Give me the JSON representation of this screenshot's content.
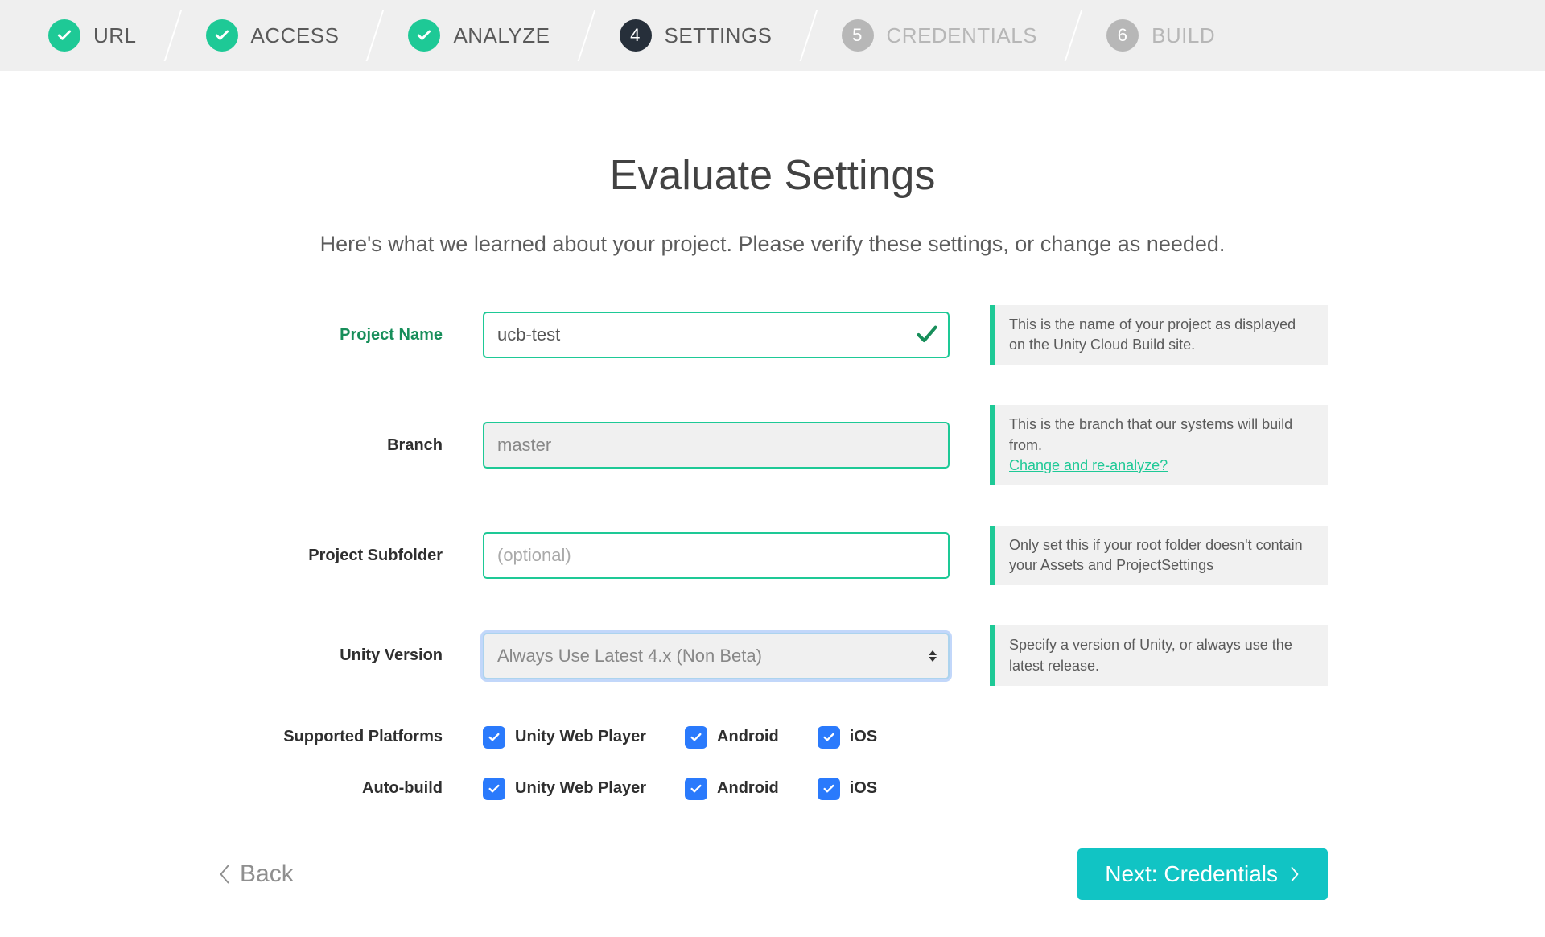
{
  "stepper": {
    "steps": [
      {
        "num": "1",
        "label": "URL",
        "state": "done"
      },
      {
        "num": "2",
        "label": "ACCESS",
        "state": "done"
      },
      {
        "num": "3",
        "label": "ANALYZE",
        "state": "done"
      },
      {
        "num": "4",
        "label": "SETTINGS",
        "state": "current"
      },
      {
        "num": "5",
        "label": "CREDENTIALS",
        "state": "upcoming"
      },
      {
        "num": "6",
        "label": "BUILD",
        "state": "upcoming"
      }
    ]
  },
  "main": {
    "title": "Evaluate Settings",
    "subtitle": "Here's what we learned about your project. Please verify these settings, or change as needed."
  },
  "fields": {
    "project_name": {
      "label": "Project Name",
      "value": "ucb-test",
      "note": "This is the name of your project as displayed on the Unity Cloud Build site.",
      "valid": true
    },
    "branch": {
      "label": "Branch",
      "value": "master",
      "note": "This is the branch that our systems will build from.",
      "note_link": "Change and re-analyze?"
    },
    "subfolder": {
      "label": "Project Subfolder",
      "value": "",
      "placeholder": "(optional)",
      "note": "Only set this if your root folder doesn't contain your Assets and ProjectSettings"
    },
    "unity_version": {
      "label": "Unity Version",
      "value": "Always Use Latest 4.x (Non Beta)",
      "note": "Specify a version of Unity, or always use the latest release."
    },
    "supported_platforms": {
      "label": "Supported Platforms",
      "options": [
        {
          "label": "Unity Web Player",
          "checked": true
        },
        {
          "label": "Android",
          "checked": true
        },
        {
          "label": "iOS",
          "checked": true
        }
      ]
    },
    "auto_build": {
      "label": "Auto-build",
      "options": [
        {
          "label": "Unity Web Player",
          "checked": true
        },
        {
          "label": "Android",
          "checked": true
        },
        {
          "label": "iOS",
          "checked": true
        }
      ]
    }
  },
  "footer": {
    "back_label": "Back",
    "next_label": "Next: Credentials"
  },
  "colors": {
    "accent_green": "#1ec996",
    "accent_teal": "#11c4c4",
    "stepper_bg": "#efefef",
    "current_badge": "#262f3a",
    "checkbox_blue": "#2a7afc"
  }
}
